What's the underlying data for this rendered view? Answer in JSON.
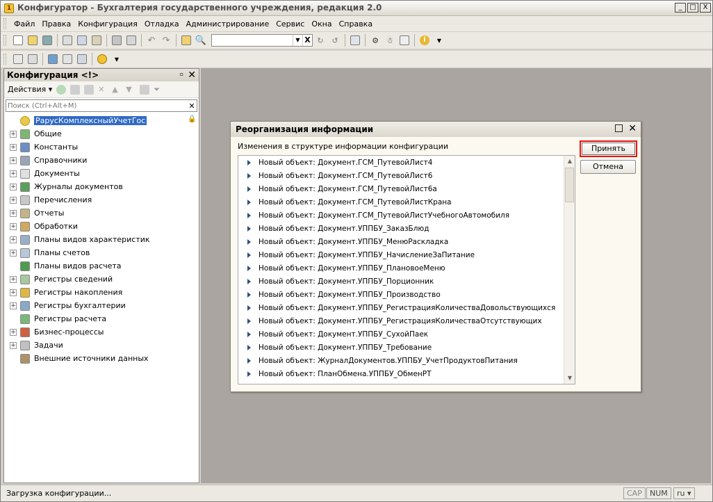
{
  "window": {
    "title": "Конфигуратор - Бухгалтерия государственного учреждения, редакция 2.0",
    "app_icon": "1c-logo-icon",
    "controls": [
      "_",
      "□",
      "X"
    ]
  },
  "menubar": {
    "items": [
      "Файл",
      "Правка",
      "Конфигурация",
      "Отладка",
      "Администрирование",
      "Сервис",
      "Окна",
      "Справка"
    ]
  },
  "toolbar": {
    "search_value": "",
    "combo_close": "X"
  },
  "config_panel": {
    "title": "Конфигурация <!>",
    "actions_label": "Действия",
    "search_placeholder": "Поиск (Ctrl+Alt+M)",
    "root_label": "РарусКомплексныйУчетГос",
    "nodes": [
      {
        "label": "Общие",
        "icon": "common-icon",
        "expandable": true
      },
      {
        "label": "Константы",
        "icon": "constants-icon",
        "expandable": true
      },
      {
        "label": "Справочники",
        "icon": "catalogs-icon",
        "expandable": true
      },
      {
        "label": "Документы",
        "icon": "documents-icon",
        "expandable": true
      },
      {
        "label": "Журналы документов",
        "icon": "journals-icon",
        "expandable": true
      },
      {
        "label": "Перечисления",
        "icon": "enums-icon",
        "expandable": true
      },
      {
        "label": "Отчеты",
        "icon": "reports-icon",
        "expandable": true
      },
      {
        "label": "Обработки",
        "icon": "dataprocessors-icon",
        "expandable": true
      },
      {
        "label": "Планы видов характеристик",
        "icon": "chart-of-characteristics-icon",
        "expandable": true
      },
      {
        "label": "Планы счетов",
        "icon": "chart-of-accounts-icon",
        "expandable": true
      },
      {
        "label": "Планы видов расчета",
        "icon": "chart-of-calculation-icon",
        "expandable": false
      },
      {
        "label": "Регистры сведений",
        "icon": "info-registers-icon",
        "expandable": true
      },
      {
        "label": "Регистры накопления",
        "icon": "accum-registers-icon",
        "expandable": true
      },
      {
        "label": "Регистры бухгалтерии",
        "icon": "accounting-registers-icon",
        "expandable": true
      },
      {
        "label": "Регистры расчета",
        "icon": "calc-registers-icon",
        "expandable": false
      },
      {
        "label": "Бизнес-процессы",
        "icon": "business-processes-icon",
        "expandable": true
      },
      {
        "label": "Задачи",
        "icon": "tasks-icon",
        "expandable": true
      },
      {
        "label": "Внешние источники данных",
        "icon": "external-sources-icon",
        "expandable": false
      }
    ]
  },
  "dialog": {
    "title": "Реорганизация информации",
    "caption": "Изменения в структуре информации конфигурации",
    "accept_label": "Принять",
    "cancel_label": "Отмена",
    "rows": [
      "Новый объект: Документ.ГСМ_ПутевойЛист4",
      "Новый объект: Документ.ГСМ_ПутевойЛист6",
      "Новый объект: Документ.ГСМ_ПутевойЛист6а",
      "Новый объект: Документ.ГСМ_ПутевойЛистКрана",
      "Новый объект: Документ.ГСМ_ПутевойЛистУчебногоАвтомобиля",
      "Новый объект: Документ.УППБУ_ЗаказБлюд",
      "Новый объект: Документ.УППБУ_МенюРаскладка",
      "Новый объект: Документ.УППБУ_НачислениеЗаПитание",
      "Новый объект: Документ.УППБУ_ПлановоеМеню",
      "Новый объект: Документ.УППБУ_Порционник",
      "Новый объект: Документ.УППБУ_Производство",
      "Новый объект: Документ.УППБУ_РегистрацияКоличестваДовольствующихся",
      "Новый объект: Документ.УППБУ_РегистрацияКоличестваОтсутствующих",
      "Новый объект: Документ.УППБУ_СухойПаек",
      "Новый объект: Документ.УППБУ_Требование",
      "Новый объект: ЖурналДокументов.УППБУ_УчетПродуктовПитания",
      "Новый объект: ПланОбмена.УППБУ_ОбменРТ"
    ]
  },
  "statusbar": {
    "text": "Загрузка конфигурации...",
    "cap": "CAP",
    "num": "NUM",
    "lang": "ru"
  },
  "colors": {
    "selection": "#316ac5",
    "highlight_border": "#e11111",
    "mdi_background": "#aaa5a0"
  }
}
